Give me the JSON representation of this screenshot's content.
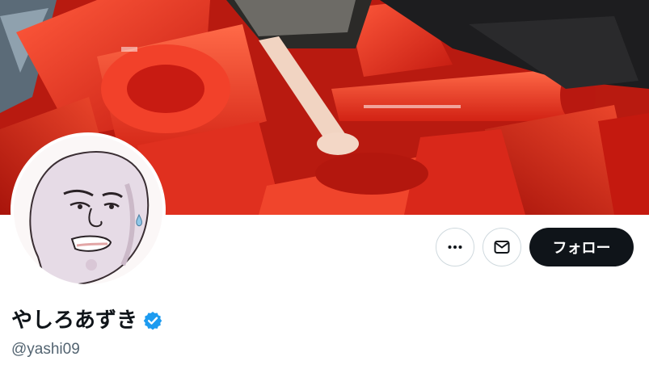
{
  "profile": {
    "display_name": "やしろあずき",
    "handle": "@yashi09",
    "verified": true
  },
  "actions": {
    "more_icon": "more-horizontal-icon",
    "message_icon": "envelope-icon",
    "follow_label": "フォロー"
  },
  "colors": {
    "verified_badge": "#1d9bf0",
    "follow_bg": "#0f1419",
    "follow_text": "#ffffff",
    "handle_text": "#536471",
    "button_border": "#cfd9de",
    "banner_red": "#e8301f"
  }
}
